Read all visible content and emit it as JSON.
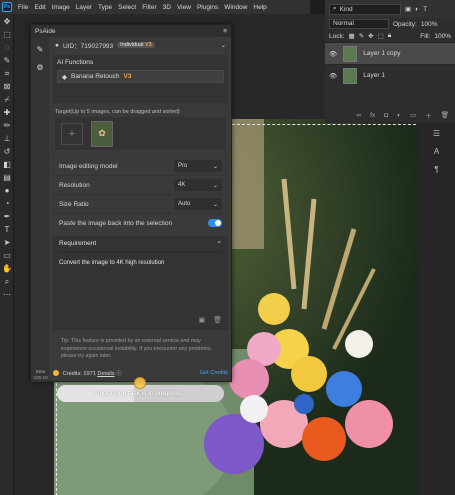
{
  "menu": [
    "File",
    "Edit",
    "Image",
    "Layer",
    "Type",
    "Select",
    "Filter",
    "3D",
    "View",
    "Plugins",
    "Window",
    "Help"
  ],
  "layers": {
    "kind_label": "Kind",
    "blend_mode": "Normal",
    "opacity_label": "Opacity:",
    "opacity_value": "100%",
    "lock_label": "Lock:",
    "fill_label": "Fill:",
    "fill_value": "100%",
    "items": [
      {
        "name": "Layer 1 copy",
        "selected": true
      },
      {
        "name": "Layer 1",
        "selected": false
      }
    ]
  },
  "panel": {
    "title": "PsAide",
    "uid": "UID：719027993",
    "plan": "Individual",
    "plan_version": "V3",
    "ai_functions_label": "AI Functions",
    "ai_function_value": "Banana Retouch",
    "ai_function_version": "V3",
    "target_label": "Target(Up to 5 images, can be dragged and sorted)",
    "options": [
      {
        "label": "Image editing model",
        "value": "Pro"
      },
      {
        "label": "Resolution",
        "value": "4K"
      },
      {
        "label": "Size Ratio",
        "value": "Auto"
      }
    ],
    "paste_back_label": "Paste the image back into the selection",
    "requirement_label": "Requirement",
    "requirement_text": "Convert the image to 4K high resolution",
    "tip": "Tip: This feature is provided by an external service and may experience occasional instability. If you encounter any problems, please try again later.",
    "credits_label": "Credits: 1971",
    "details_label": "Details",
    "get_credits_label": "Get Credits",
    "progress_text": "Photoshop task is in progress ..",
    "progress_fraction": 0.46,
    "version_line1": "Beta",
    "version_line2": "V20.10"
  }
}
